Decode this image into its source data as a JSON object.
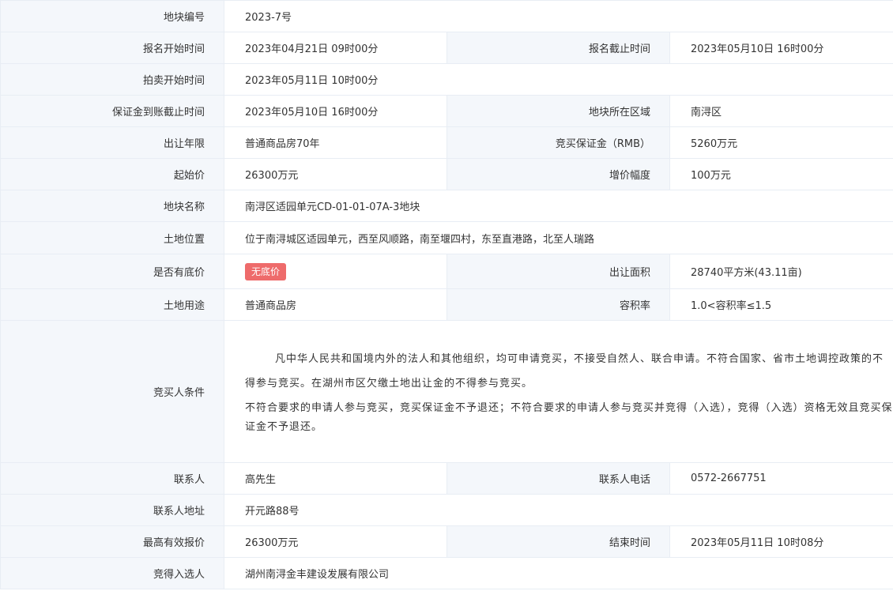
{
  "rows": {
    "plot_no": {
      "label": "地块编号",
      "value": "2023-7号"
    },
    "reg_start": {
      "label": "报名开始时间",
      "value": "2023年04月21日 09时00分"
    },
    "reg_end": {
      "label": "报名截止时间",
      "value": "2023年05月10日 16时00分"
    },
    "auction_start": {
      "label": "拍卖开始时间",
      "value": "2023年05月11日 10时00分"
    },
    "deposit_deadline": {
      "label": "保证金到账截止时间",
      "value": "2023年05月10日 16时00分"
    },
    "region": {
      "label": "地块所在区域",
      "value": "南浔区"
    },
    "term": {
      "label": "出让年限",
      "value": "普通商品房70年"
    },
    "deposit": {
      "label": "竞买保证金（RMB）",
      "value": "5260万元"
    },
    "start_price": {
      "label": "起始价",
      "value": "26300万元"
    },
    "increment": {
      "label": "增价幅度",
      "value": "100万元"
    },
    "plot_name": {
      "label": "地块名称",
      "value": "南浔区适园单元CD-01-01-07A-3地块"
    },
    "location": {
      "label": "土地位置",
      "value": "位于南浔城区适园单元，西至风顺路，南至堰四村，东至直港路，北至人瑞路"
    },
    "reserve": {
      "label": "是否有底价",
      "value": "无底价"
    },
    "area": {
      "label": "出让面积",
      "value": "28740平方米(43.11亩)"
    },
    "usage": {
      "label": "土地用途",
      "value": "普通商品房"
    },
    "far": {
      "label": "容积率",
      "value": "1.0<容积率≤1.5"
    },
    "conditions": {
      "label": "竞买人条件",
      "para1": "凡中华人民共和国境内外的法人和其他组织，均可申请竞买，不接受自然人、联合申请。不符合国家、省市土地调控政策的不得参与竞买。在湖州市区欠缴土地出让金的不得参与竞买。",
      "para2": "不符合要求的申请人参与竞买，竞买保证金不予退还；不符合要求的申请人参与竞买并竞得（入选），竞得（入选）资格无效且竞买保证金不予退还。"
    },
    "contact": {
      "label": "联系人",
      "value": "高先生"
    },
    "phone": {
      "label": "联系人电话",
      "value": "0572-2667751"
    },
    "address": {
      "label": "联系人地址",
      "value": "开元路88号"
    },
    "max_bid": {
      "label": "最高有效报价",
      "value": "26300万元"
    },
    "end_time": {
      "label": "结束时间",
      "value": "2023年05月11日 10时08分"
    },
    "winner": {
      "label": "竞得入选人",
      "value": "湖州南浔金丰建设发展有限公司"
    }
  },
  "colors": {
    "label_bg": "#f4f7fb",
    "border": "#e8edf4",
    "badge_bg": "#ee6b6b"
  }
}
